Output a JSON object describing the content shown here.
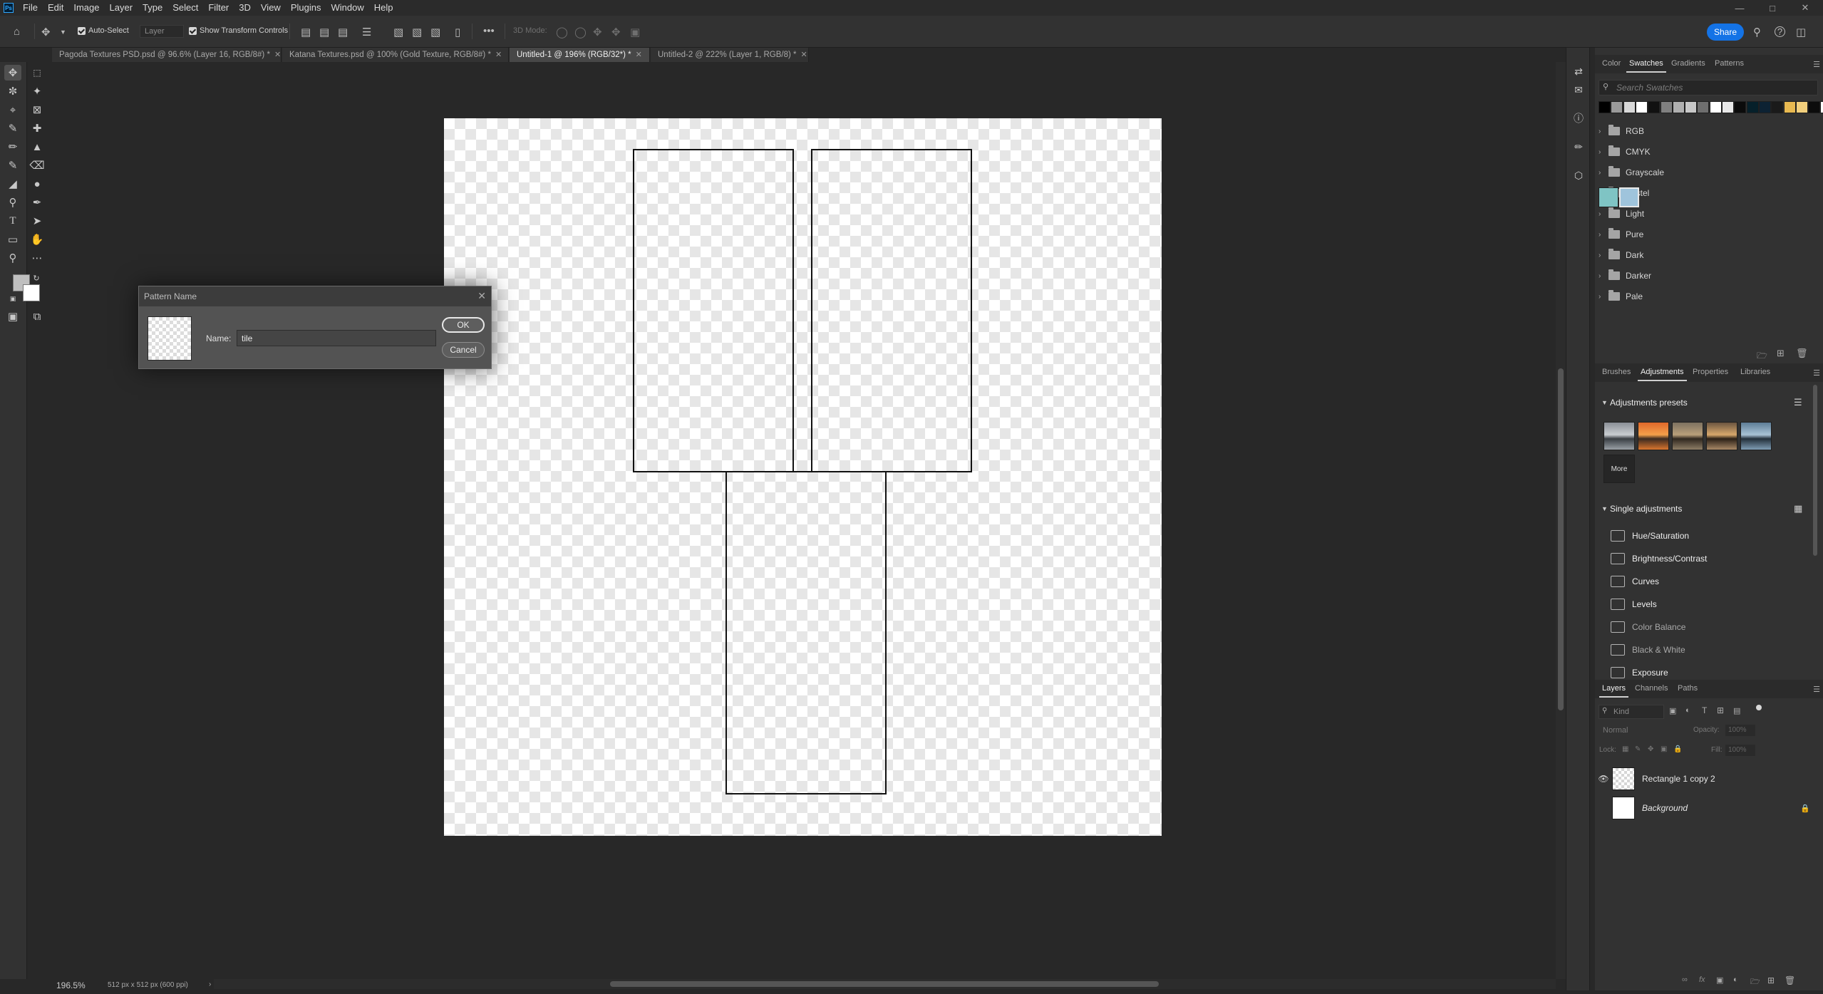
{
  "menubar": {
    "logo": "Ps",
    "items": [
      "File",
      "Edit",
      "Image",
      "Layer",
      "Type",
      "Select",
      "Filter",
      "3D",
      "View",
      "Plugins",
      "Window",
      "Help"
    ]
  },
  "options": {
    "auto_select_label": "Auto-Select",
    "auto_select_target": "Layer",
    "show_transform_label": "Show Transform Controls",
    "mode_3d_label": "3D Mode:",
    "more": "•••",
    "share_label": "Share"
  },
  "doc_tabs": [
    {
      "label": "Pagoda Textures PSD.psd @ 96.6% (Layer 16, RGB/8#) *",
      "active": false
    },
    {
      "label": "Katana Textures.psd @ 100% (Gold Texture, RGB/8#) *",
      "active": false
    },
    {
      "label": "Untitled-1 @ 196% (RGB/32*) *",
      "active": true
    },
    {
      "label": "Untitled-2 @ 222% (Layer 1, RGB/8) *",
      "active": false
    }
  ],
  "status": {
    "zoom": "196.5%",
    "doc_info": "512 px x 512 px (600 ppi)"
  },
  "dialog": {
    "title": "Pattern Name",
    "name_label": "Name:",
    "name_value": "tile",
    "ok_label": "OK",
    "cancel_label": "Cancel"
  },
  "swatches_panel": {
    "tabs": [
      "Color",
      "Swatches",
      "Gradients",
      "Patterns"
    ],
    "active_tab": "Swatches",
    "search_placeholder": "Search Swatches",
    "recent_colors": [
      "#000000",
      "#9a9a9a",
      "#d8d8d8",
      "#ffffff",
      "#111111",
      "#808080",
      "#b0b0b0",
      "#c8c8c8",
      "#6e6e6e",
      "#ffffff",
      "#e8e8e8",
      "#0b0b0b",
      "#06202a",
      "#0d2233",
      "#1a1a1a",
      "#e8b951",
      "#f2cf7c",
      "#0c0c0c",
      "#ffffff"
    ],
    "groups": [
      "RGB",
      "CMYK",
      "Grayscale",
      "Pastel",
      "Light",
      "Pure",
      "Dark",
      "Darker",
      "Pale"
    ],
    "custom_swatches": [
      "#7fc4c4",
      "#9fc4dc"
    ]
  },
  "adjustments_panel": {
    "tabs": [
      "Brushes",
      "Adjustments",
      "Properties",
      "Libraries"
    ],
    "active_tab": "Adjustments",
    "presets_heading": "Adjustments presets",
    "more_label": "More",
    "single_heading": "Single adjustments",
    "items": [
      {
        "label": "Hue/Saturation",
        "dim": false
      },
      {
        "label": "Brightness/Contrast",
        "dim": false
      },
      {
        "label": "Curves",
        "dim": false
      },
      {
        "label": "Levels",
        "dim": false
      },
      {
        "label": "Color Balance",
        "dim": true
      },
      {
        "label": "Black & White",
        "dim": true
      },
      {
        "label": "Exposure",
        "dim": false
      }
    ]
  },
  "layers_panel": {
    "tabs": [
      "Layers",
      "Channels",
      "Paths"
    ],
    "active_tab": "Layers",
    "kind_placeholder": "Kind",
    "blend_mode": "Normal",
    "opacity_label": "Opacity:",
    "opacity_value": "100%",
    "lock_label": "Lock:",
    "fill_label": "Fill:",
    "fill_value": "100%",
    "layers": [
      {
        "name": "Rectangle 1 copy 2",
        "visible": true,
        "locked": false
      },
      {
        "name": "Background",
        "visible": false,
        "locked": true
      }
    ]
  },
  "icons": {
    "home": "home-icon",
    "move": "move-icon",
    "search": "search-icon",
    "help": "help-icon",
    "workspace": "workspace-icon"
  }
}
